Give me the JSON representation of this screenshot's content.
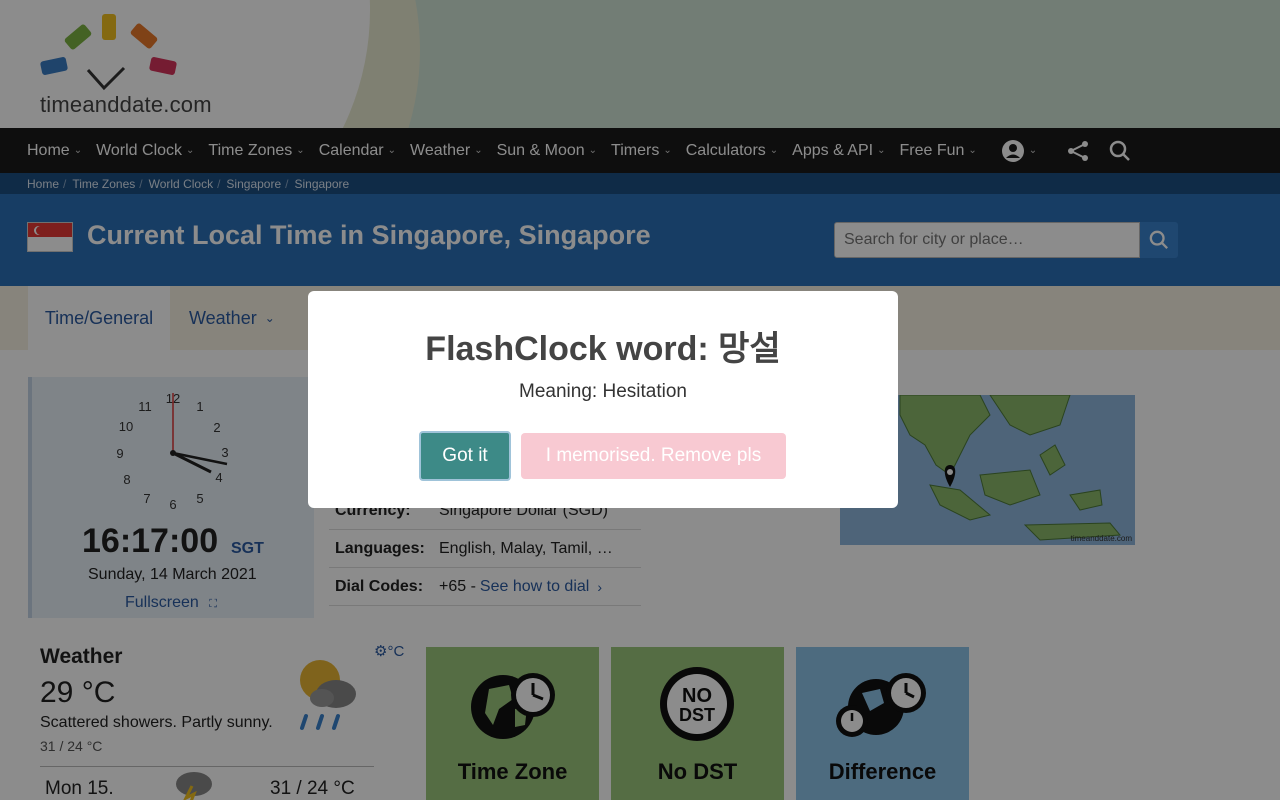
{
  "header": {
    "logo_text": "timeanddate.com"
  },
  "nav": {
    "items": [
      "Home",
      "World Clock",
      "Time Zones",
      "Calendar",
      "Weather",
      "Sun & Moon",
      "Timers",
      "Calculators",
      "Apps & API",
      "Free Fun"
    ],
    "icons": [
      "account-icon",
      "share-icon",
      "search-icon"
    ]
  },
  "breadcrumb": [
    "Home",
    "Time Zones",
    "World Clock",
    "Singapore",
    "Singapore"
  ],
  "title": "Current Local Time in Singapore, Singapore",
  "search": {
    "placeholder": "Search for city or place…"
  },
  "tabs": {
    "active": "Time/General",
    "weather": "Weather"
  },
  "clock": {
    "numbers": [
      "12",
      "1",
      "2",
      "3",
      "4",
      "5",
      "6",
      "7",
      "8",
      "9",
      "10",
      "11"
    ],
    "time": "16:17:00",
    "tz": "SGT",
    "date": "Sunday, 14 March 2021",
    "fullscreen": "Fullscreen"
  },
  "info": {
    "currency_key": "Currency:",
    "currency_val": "Singapore Dollar (SGD)",
    "languages_key": "Languages:",
    "languages_val": "English, Malay, Tamil, …",
    "dial_key": "Dial Codes:",
    "dial_val": "+65 - ",
    "dial_link": "See how to dial"
  },
  "map": {
    "credit": "timeanddate.com"
  },
  "weather": {
    "title": "Weather",
    "temp": "29 °C",
    "desc": "Scattered showers. Partly sunny.",
    "hilo": "31 / 24 °C",
    "unit": "°C",
    "forecast_day": "Mon 15.",
    "forecast_temp": "31 / 24 °C"
  },
  "tiles": {
    "timezone": "Time Zone",
    "nodst": "No DST",
    "nodst_badge_line1": "NO",
    "nodst_badge_line2": "DST",
    "difference": "Difference"
  },
  "modal": {
    "title": "FlashClock word: 망설",
    "meaning": "Meaning: Hesitation",
    "got_it": "Got it",
    "remove": "I memorised. Remove pls"
  },
  "colors": {
    "nav_bg": "#1a1a1a",
    "title_bg": "#2a6fb6",
    "got_it_bg": "#3d8a87",
    "remove_bg": "#f8c9d2"
  }
}
